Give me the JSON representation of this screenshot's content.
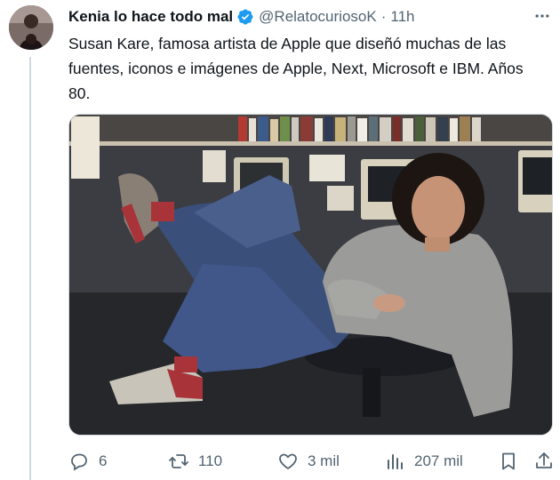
{
  "tweet": {
    "author_name": "Kenia lo hace todo mal",
    "handle": "@RelatocuriosoK",
    "separator": "·",
    "time": "11h",
    "text": "Susan Kare, famosa artista de Apple que diseñó muchas de las fuentes, iconos e imágenes de Apple, Next, Microsoft e IBM. Años 80.",
    "avatar_icon": "user-avatar",
    "verified_icon": "verified-badge-icon",
    "more_icon": "more-options-icon",
    "media_description": "photo"
  },
  "actions": {
    "replies": "6",
    "reposts": "110",
    "likes": "3 mil",
    "views": "207 mil"
  },
  "colors": {
    "text": "#0f1419",
    "secondary": "#536471",
    "verified": "#1d9bf0",
    "border": "#cfd9de"
  }
}
